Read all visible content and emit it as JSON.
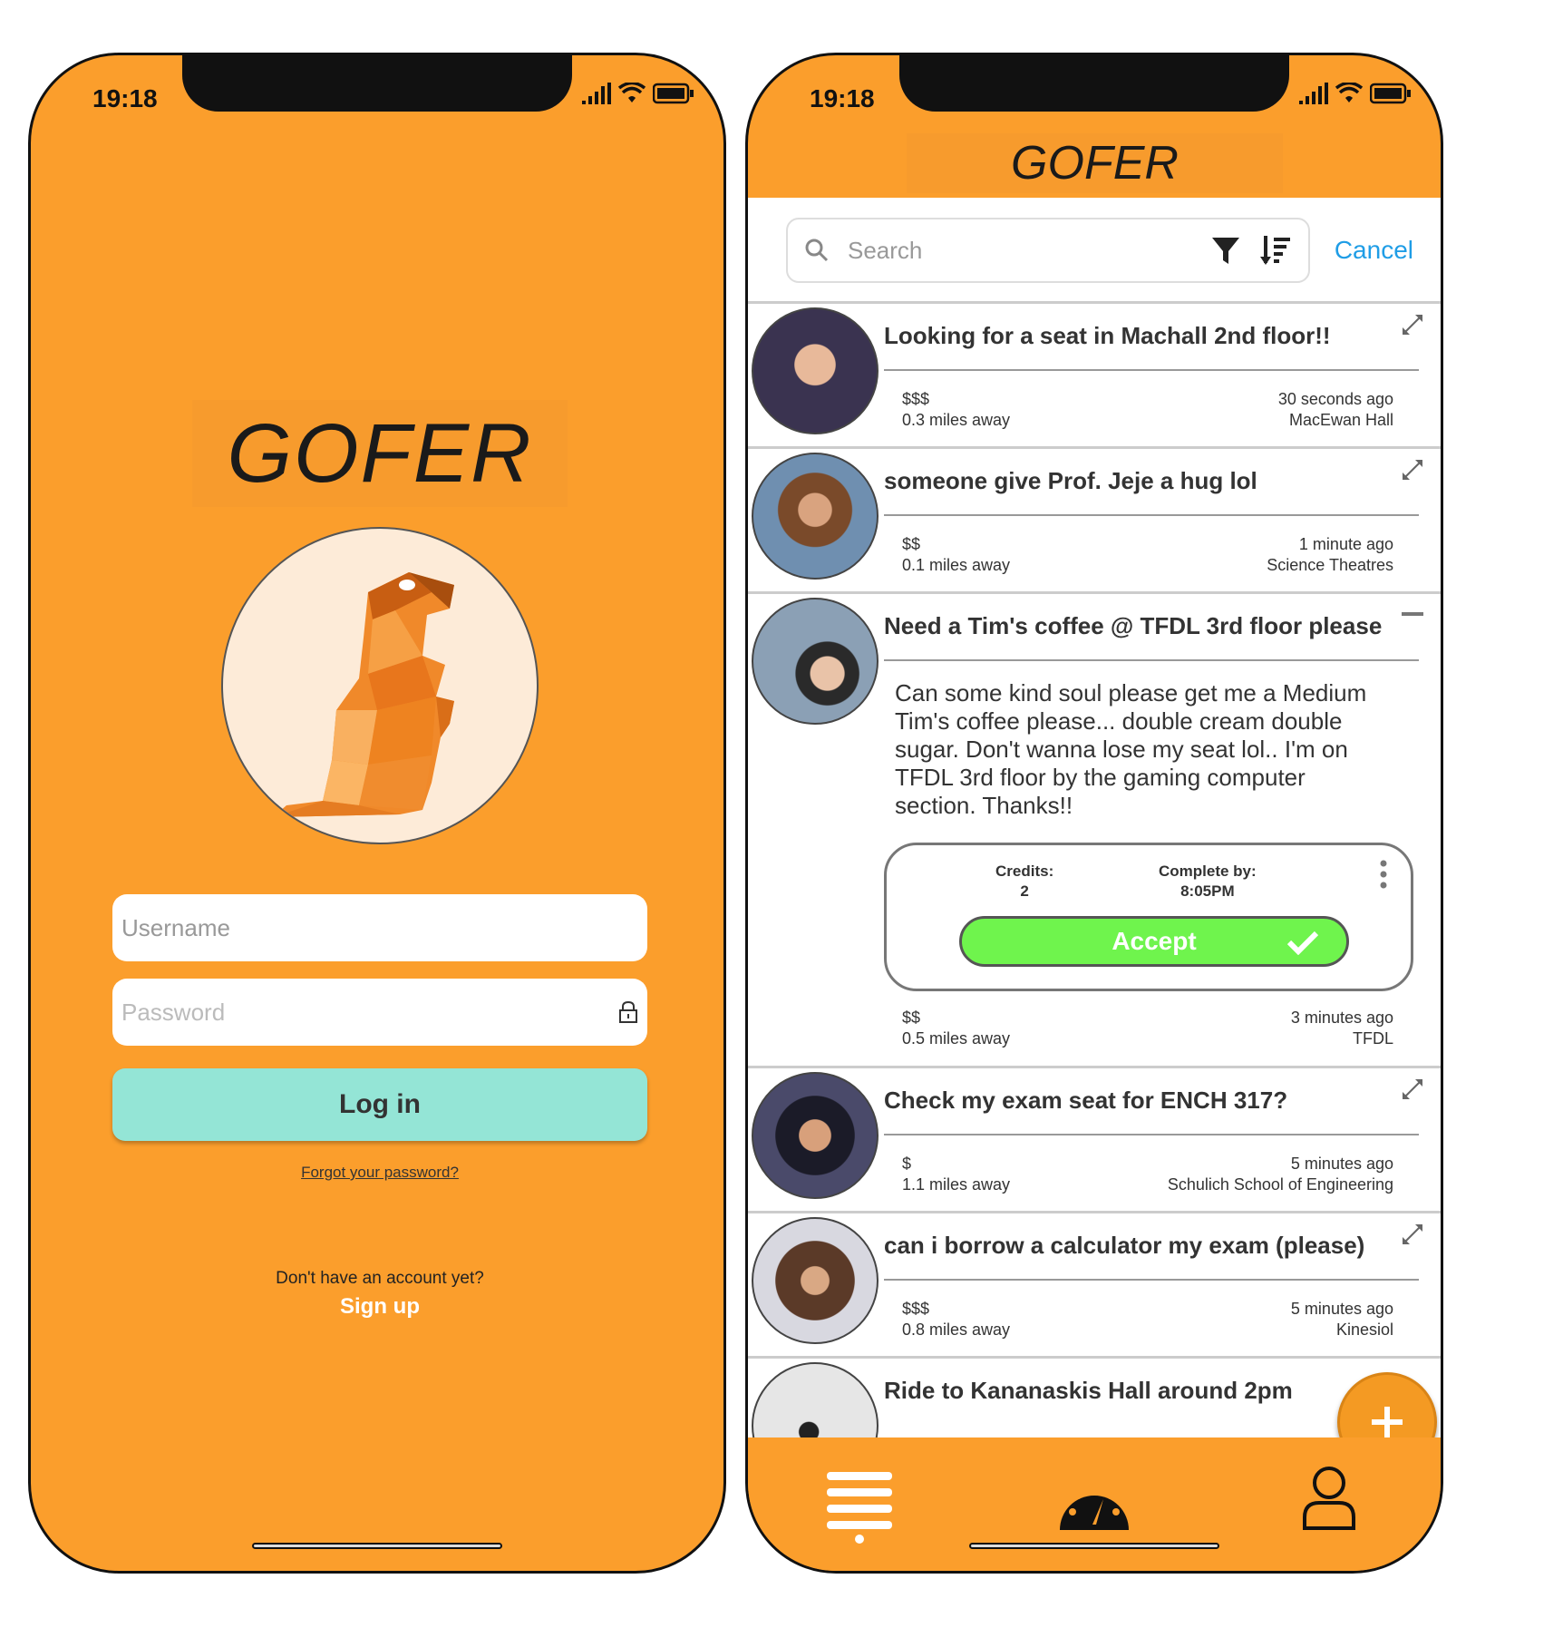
{
  "status_bar": {
    "time": "19:18"
  },
  "login": {
    "brand": "GOFER",
    "username_placeholder": "Username",
    "password_placeholder": "Password",
    "login_label": "Log in",
    "forgot_label": "Forgot your password?",
    "no_account_label": "Don't have an account yet?",
    "signup_label": "Sign up"
  },
  "feed": {
    "header_title": "GOFER",
    "search_placeholder": "Search",
    "cancel_label": "Cancel",
    "posts": [
      {
        "title": "Looking for a seat in Machall 2nd floor!!",
        "price": "$$$",
        "distance": "0.3 miles away",
        "time": "30 seconds ago",
        "location": "MacEwan Hall"
      },
      {
        "title": "someone give Prof. Jeje a hug lol",
        "price": "$$",
        "distance": "0.1 miles away",
        "time": "1 minute ago",
        "location": "Science Theatres"
      },
      {
        "title": "Need a Tim's coffee @ TFDL 3rd floor please",
        "description": "Can some kind soul please get me a Medium Tim's coffee please... double cream double sugar. Don't wanna lose my seat lol.. I'm on TFDL 3rd floor by the gaming computer section. Thanks!!",
        "credits_label": "Credits:",
        "credits_value": "2",
        "complete_by_label": "Complete by:",
        "complete_by_value": "8:05PM",
        "accept_label": "Accept",
        "price": "$$",
        "distance": "0.5 miles away",
        "time": "3 minutes ago",
        "location": "TFDL"
      },
      {
        "title": "Check my exam seat for ENCH 317?",
        "price": "$",
        "distance": "1.1 miles away",
        "time": "5 minutes ago",
        "location": "Schulich School of Engineering"
      },
      {
        "title": "can i borrow a calculator my exam (please)",
        "price": "$$$",
        "distance": "0.8 miles away",
        "time": "5 minutes ago",
        "location": "Kinesiol"
      },
      {
        "title": "Ride to Kananaskis Hall around 2pm"
      }
    ],
    "fab_icon": "plus-icon",
    "nav": [
      "list-icon",
      "dashboard-icon",
      "profile-icon"
    ]
  },
  "colors": {
    "background": "#fb9e2c",
    "login_button": "#94e5d6",
    "accept_button": "#6ff44d",
    "link": "#1f9de6"
  }
}
